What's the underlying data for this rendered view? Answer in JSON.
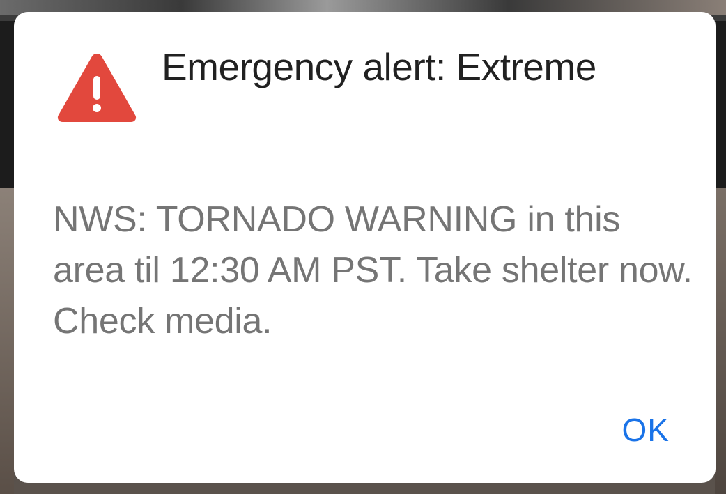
{
  "dialog": {
    "icon": "warning-triangle-icon",
    "title": "Emergency alert: Extreme",
    "message": "NWS: TORNADO WARNING in this area til 12:30 AM PST. Take shelter now. Check media.",
    "ok_label": "OK"
  },
  "colors": {
    "icon_red": "#E2483D",
    "title_text": "#212121",
    "message_text": "#757575",
    "button_blue": "#1A73E8"
  }
}
